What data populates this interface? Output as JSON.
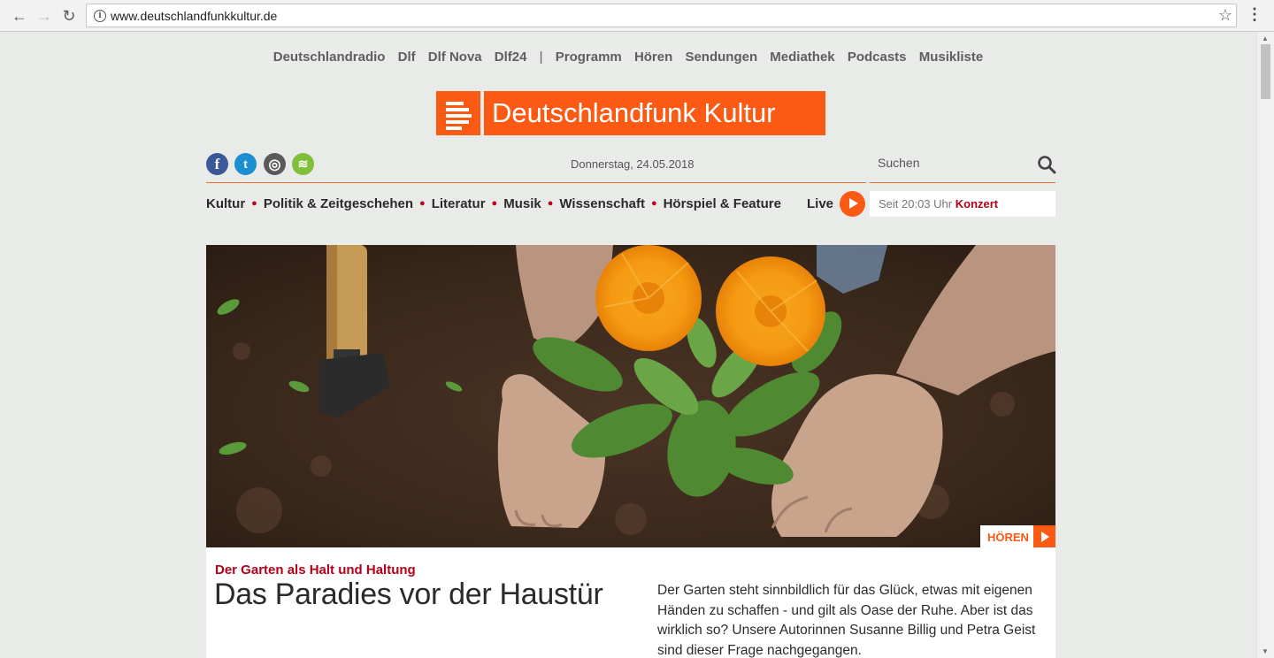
{
  "browser": {
    "url": "www.deutschlandfunkkultur.de",
    "back_icon": "←",
    "forward_icon": "→",
    "reload_icon": "↻",
    "info_icon": "i",
    "star_icon": "☆",
    "menu_icon": "⋮"
  },
  "network_nav": [
    "Deutschlandradio",
    "Dlf",
    "Dlf Nova",
    "Dlf24",
    "|",
    "Programm",
    "Hören",
    "Sendungen",
    "Mediathek",
    "Podcasts",
    "Musikliste"
  ],
  "logo": {
    "text": "Deutschlandfunk Kultur",
    "color": "#fa5a14"
  },
  "social": {
    "facebook": "f",
    "twitter": "t",
    "instagram": "◎",
    "spotify": "≋"
  },
  "date": "Donnerstag, 24.05.2018",
  "search": {
    "label": "Suchen"
  },
  "sections": [
    "Kultur",
    "Politik & Zeitgeschehen",
    "Literatur",
    "Musik",
    "Wissenschaft",
    "Hörspiel & Feature"
  ],
  "live": {
    "label": "Live",
    "since": "Seit 20:03 Uhr",
    "program": "Konzert"
  },
  "hero": {
    "listen_label": "HÖREN"
  },
  "article": {
    "kicker": "Der Garten als Halt und Haltung",
    "title": "Das Paradies vor der Haustür",
    "teaser": "Der Garten steht sinnbildlich für das Glück, etwas mit eigenen Händen zu schaffen - und gilt als Oase der Ruhe. Aber ist das wirklich so? Unsere Autorinnen Susanne Billig und Petra Geist sind dieser Frage nachgegangen."
  }
}
